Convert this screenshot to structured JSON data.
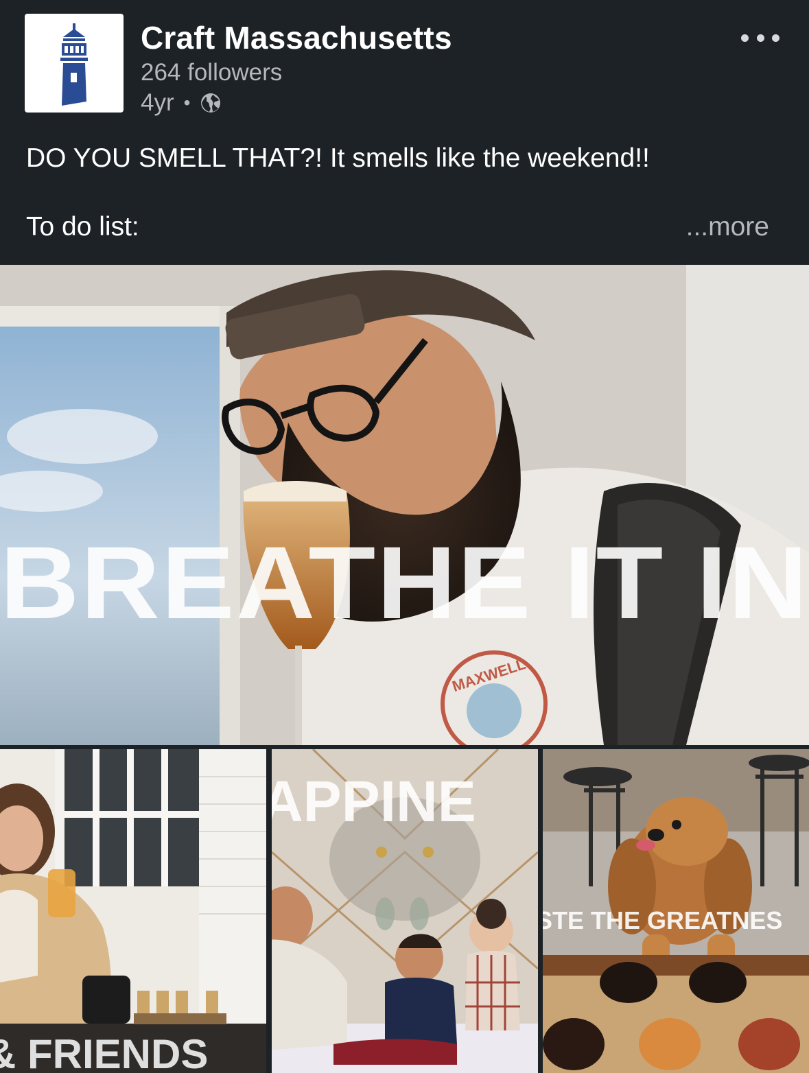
{
  "post": {
    "author": {
      "name": "Craft Massachusetts",
      "followers": "264 followers",
      "time": "4yr",
      "visibility_icon": "globe-icon"
    },
    "menu_icon": "more-options-icon",
    "text_line1": "DO YOU SMELL THAT?! It smells like the weekend!!",
    "text_line2": "To do list:",
    "see_more": "...more"
  },
  "images": {
    "hero": {
      "overlay_text": "BREATHE IT IN",
      "shirt_text": "MAXWELL"
    },
    "thumb1": {
      "overlay_text": "& FRIENDS"
    },
    "thumb2": {
      "overlay_text": "APPINE"
    },
    "thumb3": {
      "overlay_text": "STE THE GREATNES"
    }
  },
  "colors": {
    "background": "#1d2226",
    "text_primary": "#ffffff",
    "text_secondary": "#b5b9bc",
    "logo_blue": "#2a4c94"
  }
}
